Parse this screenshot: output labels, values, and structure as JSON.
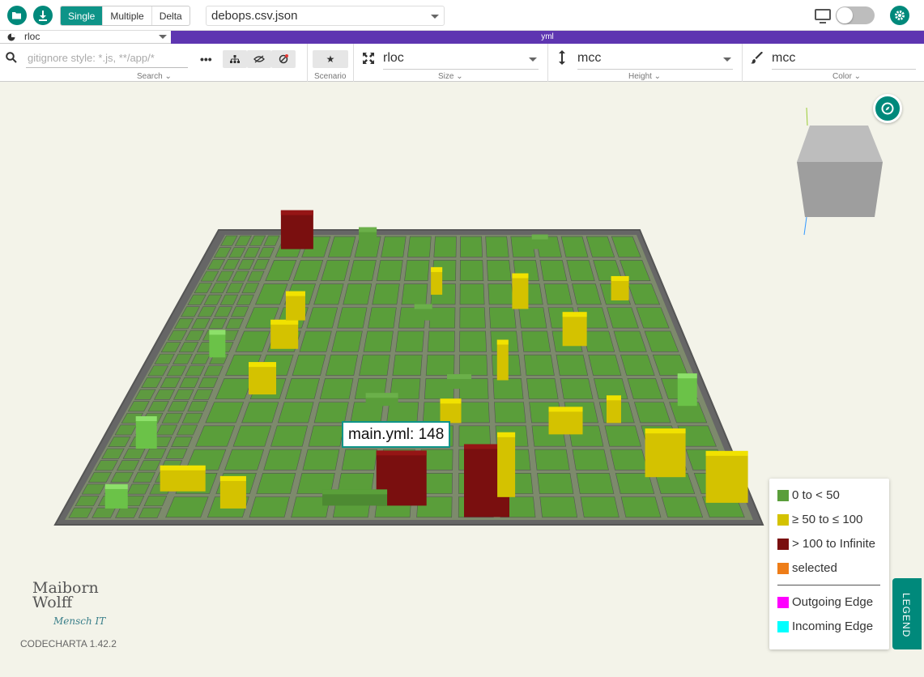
{
  "toolbar": {
    "mode_tabs": [
      "Single",
      "Multiple",
      "Delta"
    ],
    "active_mode": "Single",
    "file": "debops.csv.json"
  },
  "subbar": {
    "area_metric": "rloc",
    "yml_label": "yml"
  },
  "ribbon": {
    "search_placeholder": "gitignore style: *.js, **/app/*",
    "search_label": "Search",
    "scenario_label": "Scenario",
    "size_metric": "rloc",
    "size_label": "Size",
    "height_metric": "mcc",
    "height_label": "Height",
    "color_metric": "mcc",
    "color_label": "Color"
  },
  "tooltip": "main.yml: 148",
  "legend": {
    "items": [
      {
        "label": "0 to < 50",
        "color": "#5a9e3a"
      },
      {
        "label": "≥ 50 to ≤ 100",
        "color": "#d4c200"
      },
      {
        "label": "> 100 to Infinite",
        "color": "#7a0f0f"
      },
      {
        "label": "selected",
        "color": "#ee7d18"
      }
    ],
    "edges": [
      {
        "label": "Outgoing Edge",
        "color": "#ff00ff"
      },
      {
        "label": "Incoming Edge",
        "color": "#00ffff"
      }
    ],
    "tab_label": "LEGEND"
  },
  "branding": {
    "logo_line1": "Maiborn",
    "logo_line2": "Wolff",
    "logo_sub": "Mensch IT",
    "version": "CODECHARTA 1.42.2"
  },
  "colors": {
    "accent": "#00897b",
    "purple": "#5e35b1",
    "green": "#5a9e3a",
    "yellow": "#d4c200",
    "red": "#7a0f0f"
  }
}
